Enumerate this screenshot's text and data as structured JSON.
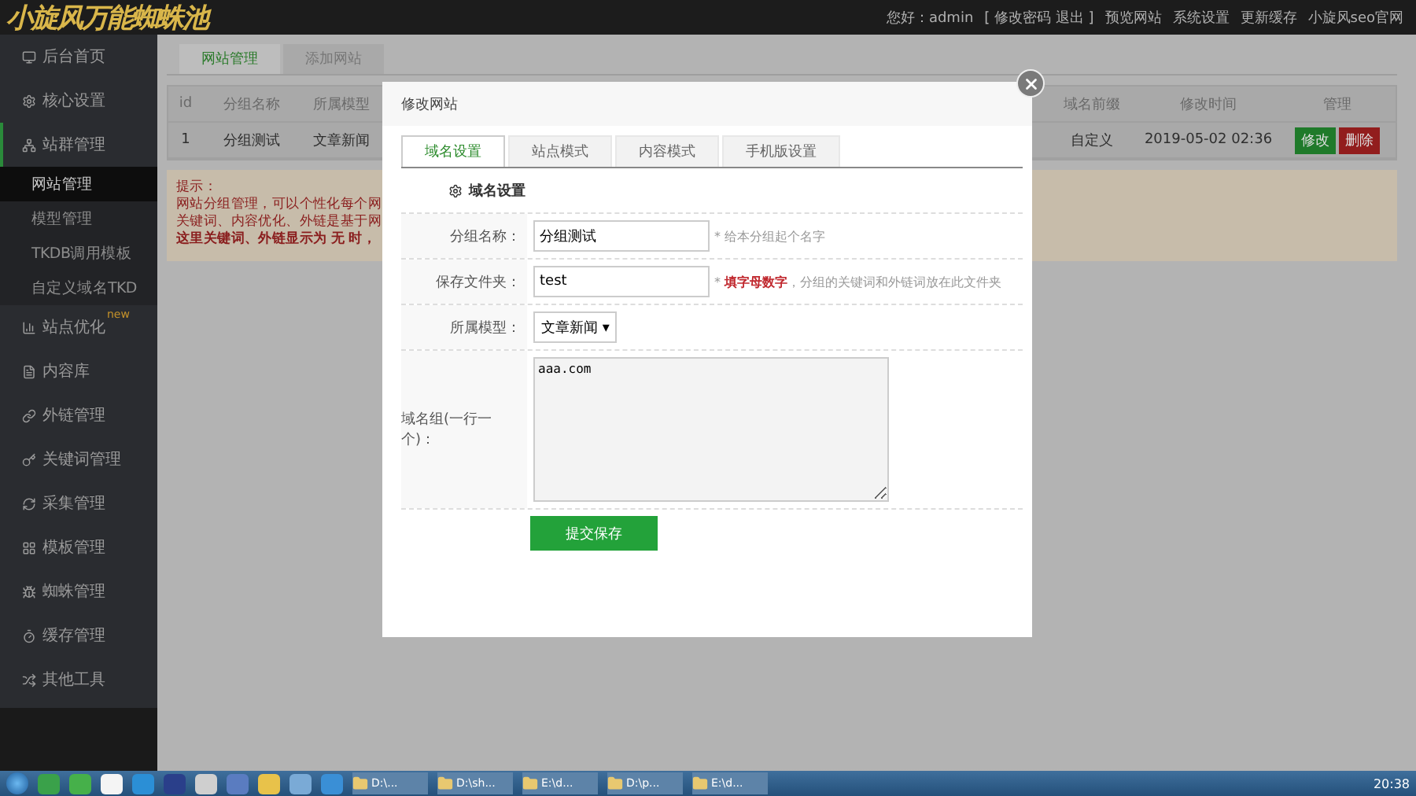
{
  "header": {
    "logo": "小旋风万能蜘蛛池",
    "greeting": "您好：admin",
    "links": [
      "[ 修改密码 退出 ]",
      "预览网站",
      "系统设置",
      "更新缓存",
      "小旋风seo官网"
    ]
  },
  "sidebar": {
    "items": [
      {
        "label": "后台首页",
        "expanded": false
      },
      {
        "label": "核心设置",
        "expanded": false
      },
      {
        "label": "站群管理",
        "expanded": true,
        "children": [
          {
            "label": "网站管理",
            "selected": true
          },
          {
            "label": "模型管理",
            "selected": false
          },
          {
            "label": "TKDB调用模板",
            "selected": false
          },
          {
            "label": "自定义域名TKD",
            "selected": false
          }
        ]
      },
      {
        "label": "站点优化",
        "expanded": false,
        "badge": "new"
      },
      {
        "label": "内容库",
        "expanded": false
      },
      {
        "label": "外链管理",
        "expanded": false
      },
      {
        "label": "关键词管理",
        "expanded": false
      },
      {
        "label": "采集管理",
        "expanded": false
      },
      {
        "label": "模板管理",
        "expanded": false
      },
      {
        "label": "蜘蛛管理",
        "expanded": false
      },
      {
        "label": "缓存管理",
        "expanded": false
      },
      {
        "label": "其他工具",
        "expanded": false
      }
    ]
  },
  "page_tabs": [
    {
      "label": "网站管理",
      "selected": true
    },
    {
      "label": "添加网站",
      "selected": false
    }
  ],
  "table": {
    "columns": [
      "id",
      "分组名称",
      "所属模型",
      "域名前缀",
      "修改时间",
      "管理"
    ],
    "rows": [
      {
        "cells": [
          "1",
          "分组测试",
          "文章新闻",
          "自定义",
          "2019-05-02 02:36"
        ],
        "actions": [
          {
            "label": "修改",
            "kind": "edit"
          },
          {
            "label": "删除",
            "kind": "delete"
          }
        ]
      }
    ]
  },
  "tip": {
    "title": "提示：",
    "lines": [
      "网站分组管理，可以个性化每个网",
      "关键词、内容优化、外链是基于网",
      "**这里关键词、外链显示为 无 时，**"
    ]
  },
  "modal": {
    "title": "修改网站",
    "tabs": [
      {
        "label": "域名设置",
        "selected": true
      },
      {
        "label": "站点模式",
        "selected": false
      },
      {
        "label": "内容模式",
        "selected": false
      },
      {
        "label": "手机版设置",
        "selected": false
      }
    ],
    "section": "域名设置",
    "fields": [
      {
        "kind": "input",
        "label": "分组名称：",
        "value": "分组测试",
        "hint": "* 给本分组起个名字"
      },
      {
        "kind": "input",
        "label": "保存文件夹：",
        "value": "test",
        "hint": "* **填字母数字**，分组的关键词和外链词放在此文件夹"
      },
      {
        "kind": "select",
        "label": "所属模型：",
        "value": "文章新闻 ▾"
      },
      {
        "kind": "textarea",
        "label": "域名组(一行一个)：",
        "value": "aaa.com"
      }
    ],
    "submit": "提交保存"
  },
  "taskbar": {
    "tasks": [
      "D:\\...",
      "D:\\sh...",
      "E:\\d...",
      "D:\\p...",
      "E:\\d..."
    ],
    "clock": "20:38"
  }
}
